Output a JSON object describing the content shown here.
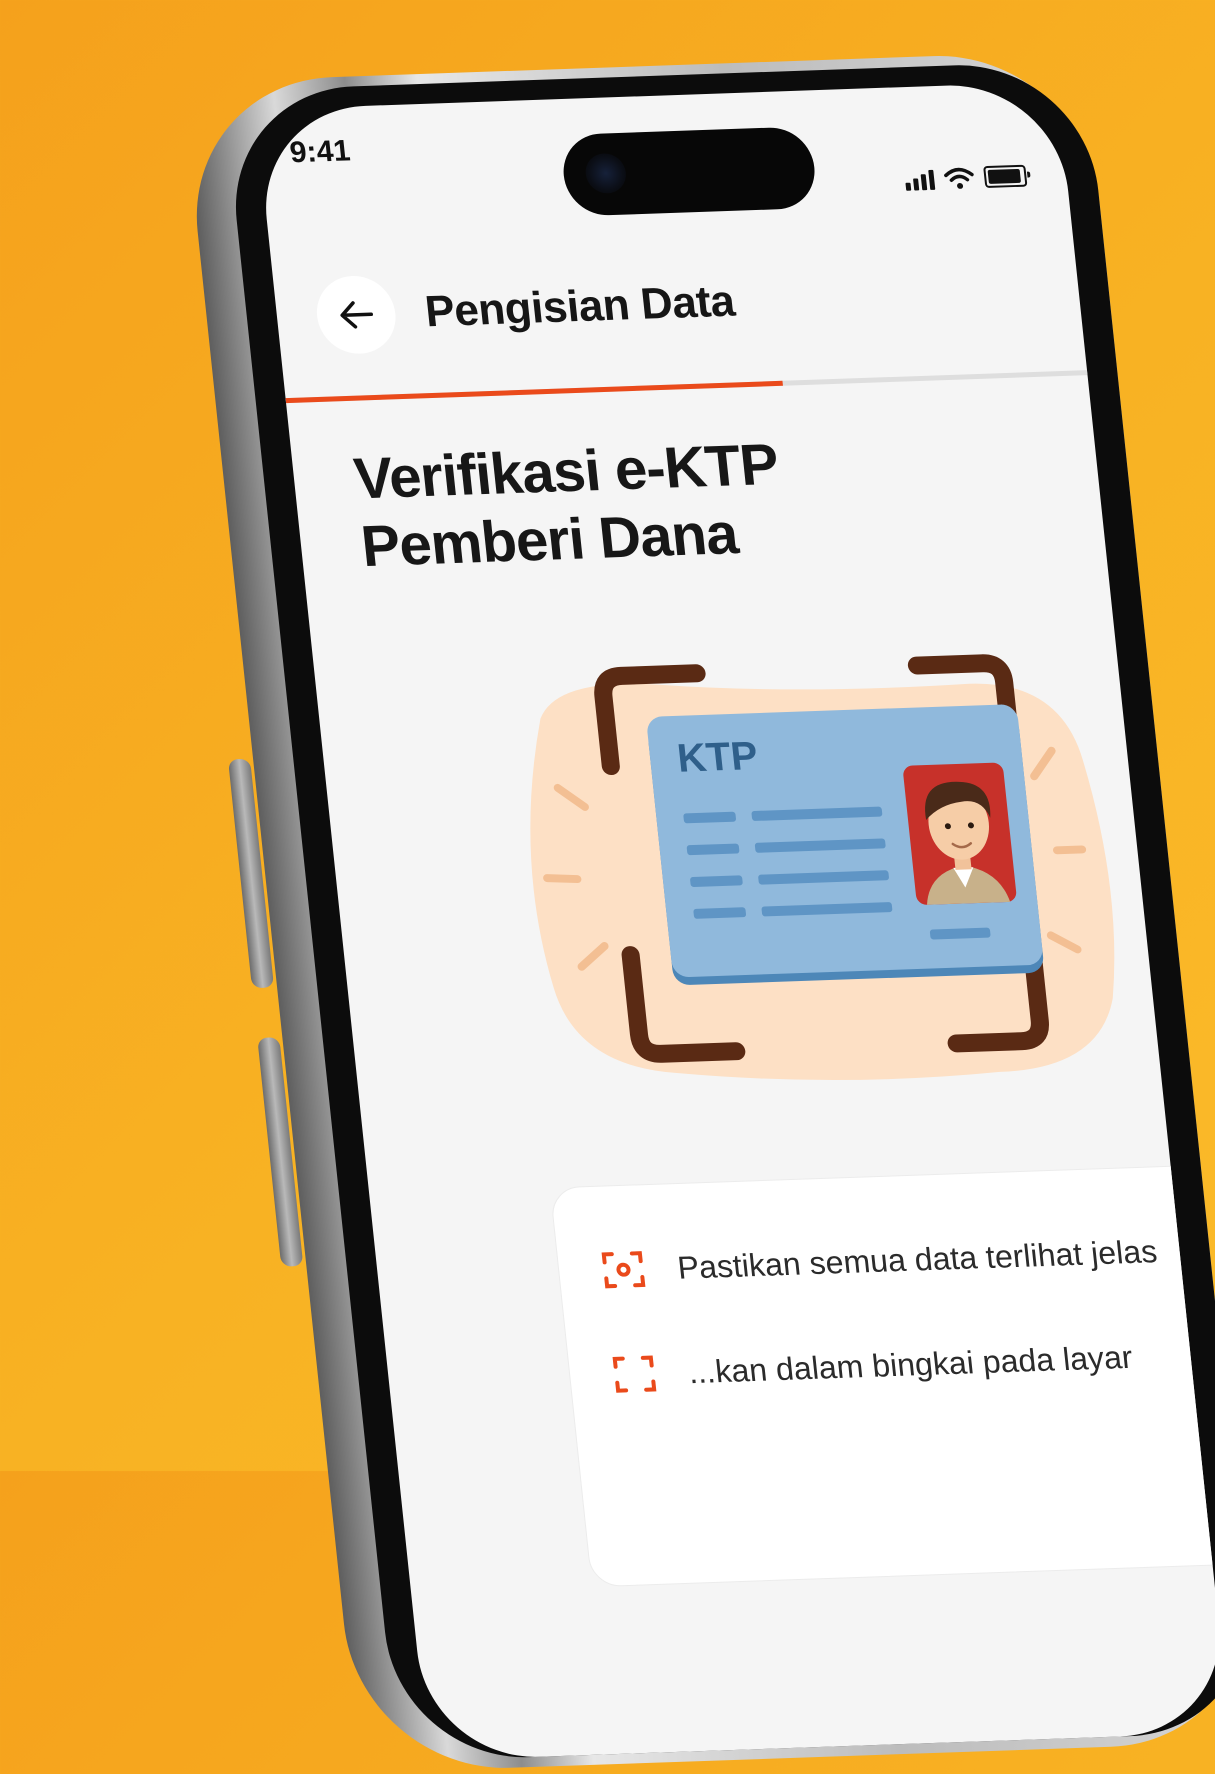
{
  "status_bar": {
    "time": "9:41",
    "icons": [
      "signal-icon",
      "wifi-icon",
      "battery-icon"
    ]
  },
  "header": {
    "back_icon": "arrow-left-icon",
    "title": "Pengisian Data"
  },
  "progress": {
    "value": 0.62,
    "accent_color": "#ea4a1b"
  },
  "page": {
    "title_line1": "Verifikasi e-KTP",
    "title_line2": "Pemberi Dana"
  },
  "illustration": {
    "card_label": "KTP"
  },
  "tips": [
    {
      "icon": "scan-focus-icon",
      "text": "Pastikan semua data terlihat jelas"
    },
    {
      "icon": "scan-frame-icon",
      "text": "...kan dalam bingkai pada layar"
    }
  ],
  "colors": {
    "background": "#f8b223",
    "screen": "#f5f5f5",
    "accent": "#ea4a1b"
  }
}
